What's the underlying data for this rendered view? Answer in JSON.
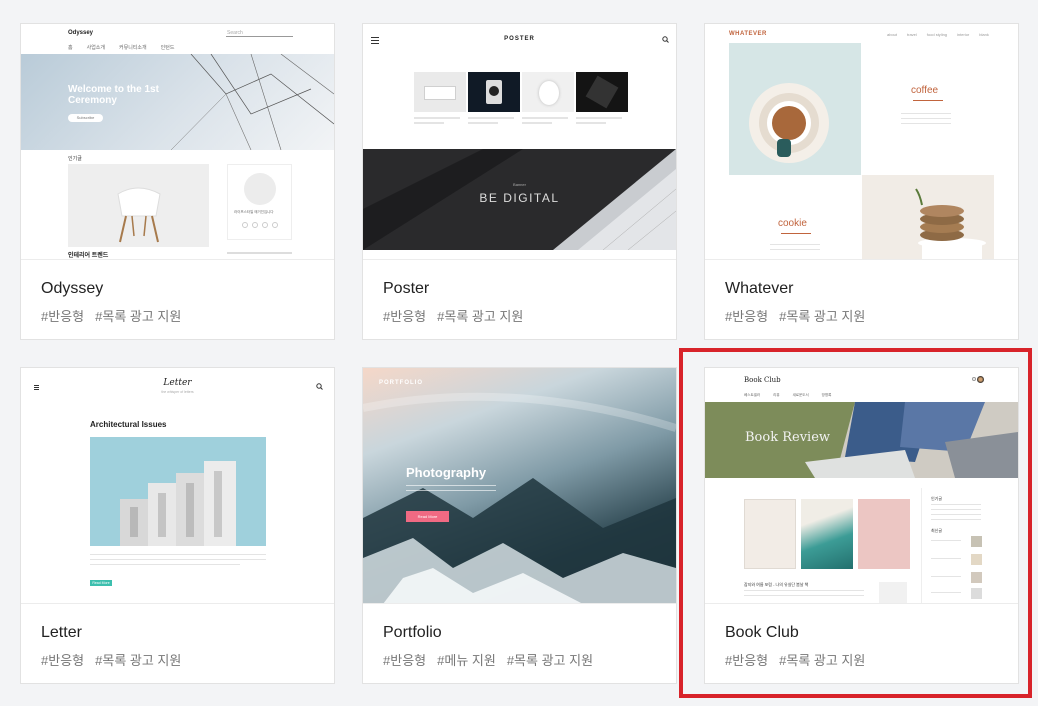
{
  "accent": "#d8232a",
  "cards": [
    {
      "name": "Odyssey",
      "tags": [
        "#반응형",
        "#목록 광고 지원"
      ],
      "preview": {
        "logo": "Odyssey",
        "search": "Search",
        "nav": [
          "홈",
          "사업소개",
          "커뮤니티소개",
          "인턴드"
        ],
        "hero_title": "Welcome to the 1st Ceremony",
        "hero_button": "Subscribe",
        "section_label": "인기글",
        "post_title": "인테리어 트렌드",
        "side_note": "라이프스타일 매거진입니다"
      }
    },
    {
      "name": "Poster",
      "tags": [
        "#반응형",
        "#목록 광고 지원"
      ],
      "preview": {
        "logo": "POSTER",
        "banner_small": "Banner",
        "banner_title": "BE DIGITAL",
        "products": [
          "Speaker",
          "Camera",
          "Mouse",
          "Phone"
        ]
      }
    },
    {
      "name": "Whatever",
      "tags": [
        "#반응형",
        "#목록 광고 지원"
      ],
      "preview": {
        "logo": "WHATEVER",
        "nav": [
          "about",
          "travel",
          "food styling",
          "interior",
          "blank"
        ],
        "coffee_label": "coffee",
        "cookie_label": "cookie"
      }
    },
    {
      "name": "Letter",
      "tags": [
        "#반응형",
        "#목록 광고 지원"
      ],
      "preview": {
        "logo": "Letter",
        "subtitle": "the whisper of letters",
        "post_title": "Architectural Issues",
        "read_more": "Read More"
      }
    },
    {
      "name": "Portfolio",
      "tags": [
        "#반응형",
        "#메뉴 지원",
        "#목록 광고 지원"
      ],
      "preview": {
        "logo": "PORTFOLIO",
        "hero_title": "Photography",
        "hero_button": "Read More"
      }
    },
    {
      "name": "Book Club",
      "tags": [
        "#반응형",
        "#목록 광고 지원"
      ],
      "selected": true,
      "preview": {
        "logo": "Book Club",
        "nav": [
          "베스트셀러",
          "리뷰",
          "새로운도서",
          "방명록"
        ],
        "hero_title": "Book Review",
        "post_title": "잡지와 여름 포럼 - 나의 유실단 봄날 책",
        "side_head": "인기글",
        "side_head2": "최신글"
      }
    }
  ]
}
